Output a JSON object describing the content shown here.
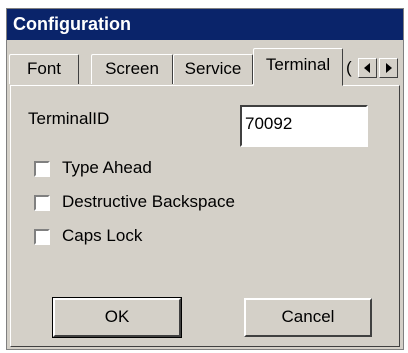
{
  "window": {
    "title": "Configuration"
  },
  "tabs": [
    {
      "label": "Font"
    },
    {
      "label": "Screen"
    },
    {
      "label": "Service"
    },
    {
      "label": "Terminal"
    }
  ],
  "tab_overflow_label": "(",
  "terminal": {
    "terminal_id_label": "TerminalID",
    "terminal_id_value": "70092",
    "checkboxes": [
      {
        "label": "Type Ahead",
        "checked": false
      },
      {
        "label": "Destructive Backspace",
        "checked": false
      },
      {
        "label": "Caps Lock",
        "checked": false
      }
    ]
  },
  "buttons": {
    "ok": "OK",
    "cancel": "Cancel"
  },
  "icons": {
    "scroll_left": "triangle-left-icon",
    "scroll_right": "triangle-right-icon"
  },
  "colors": {
    "titlebar": "#0a246a",
    "face": "#d4d0c8"
  }
}
